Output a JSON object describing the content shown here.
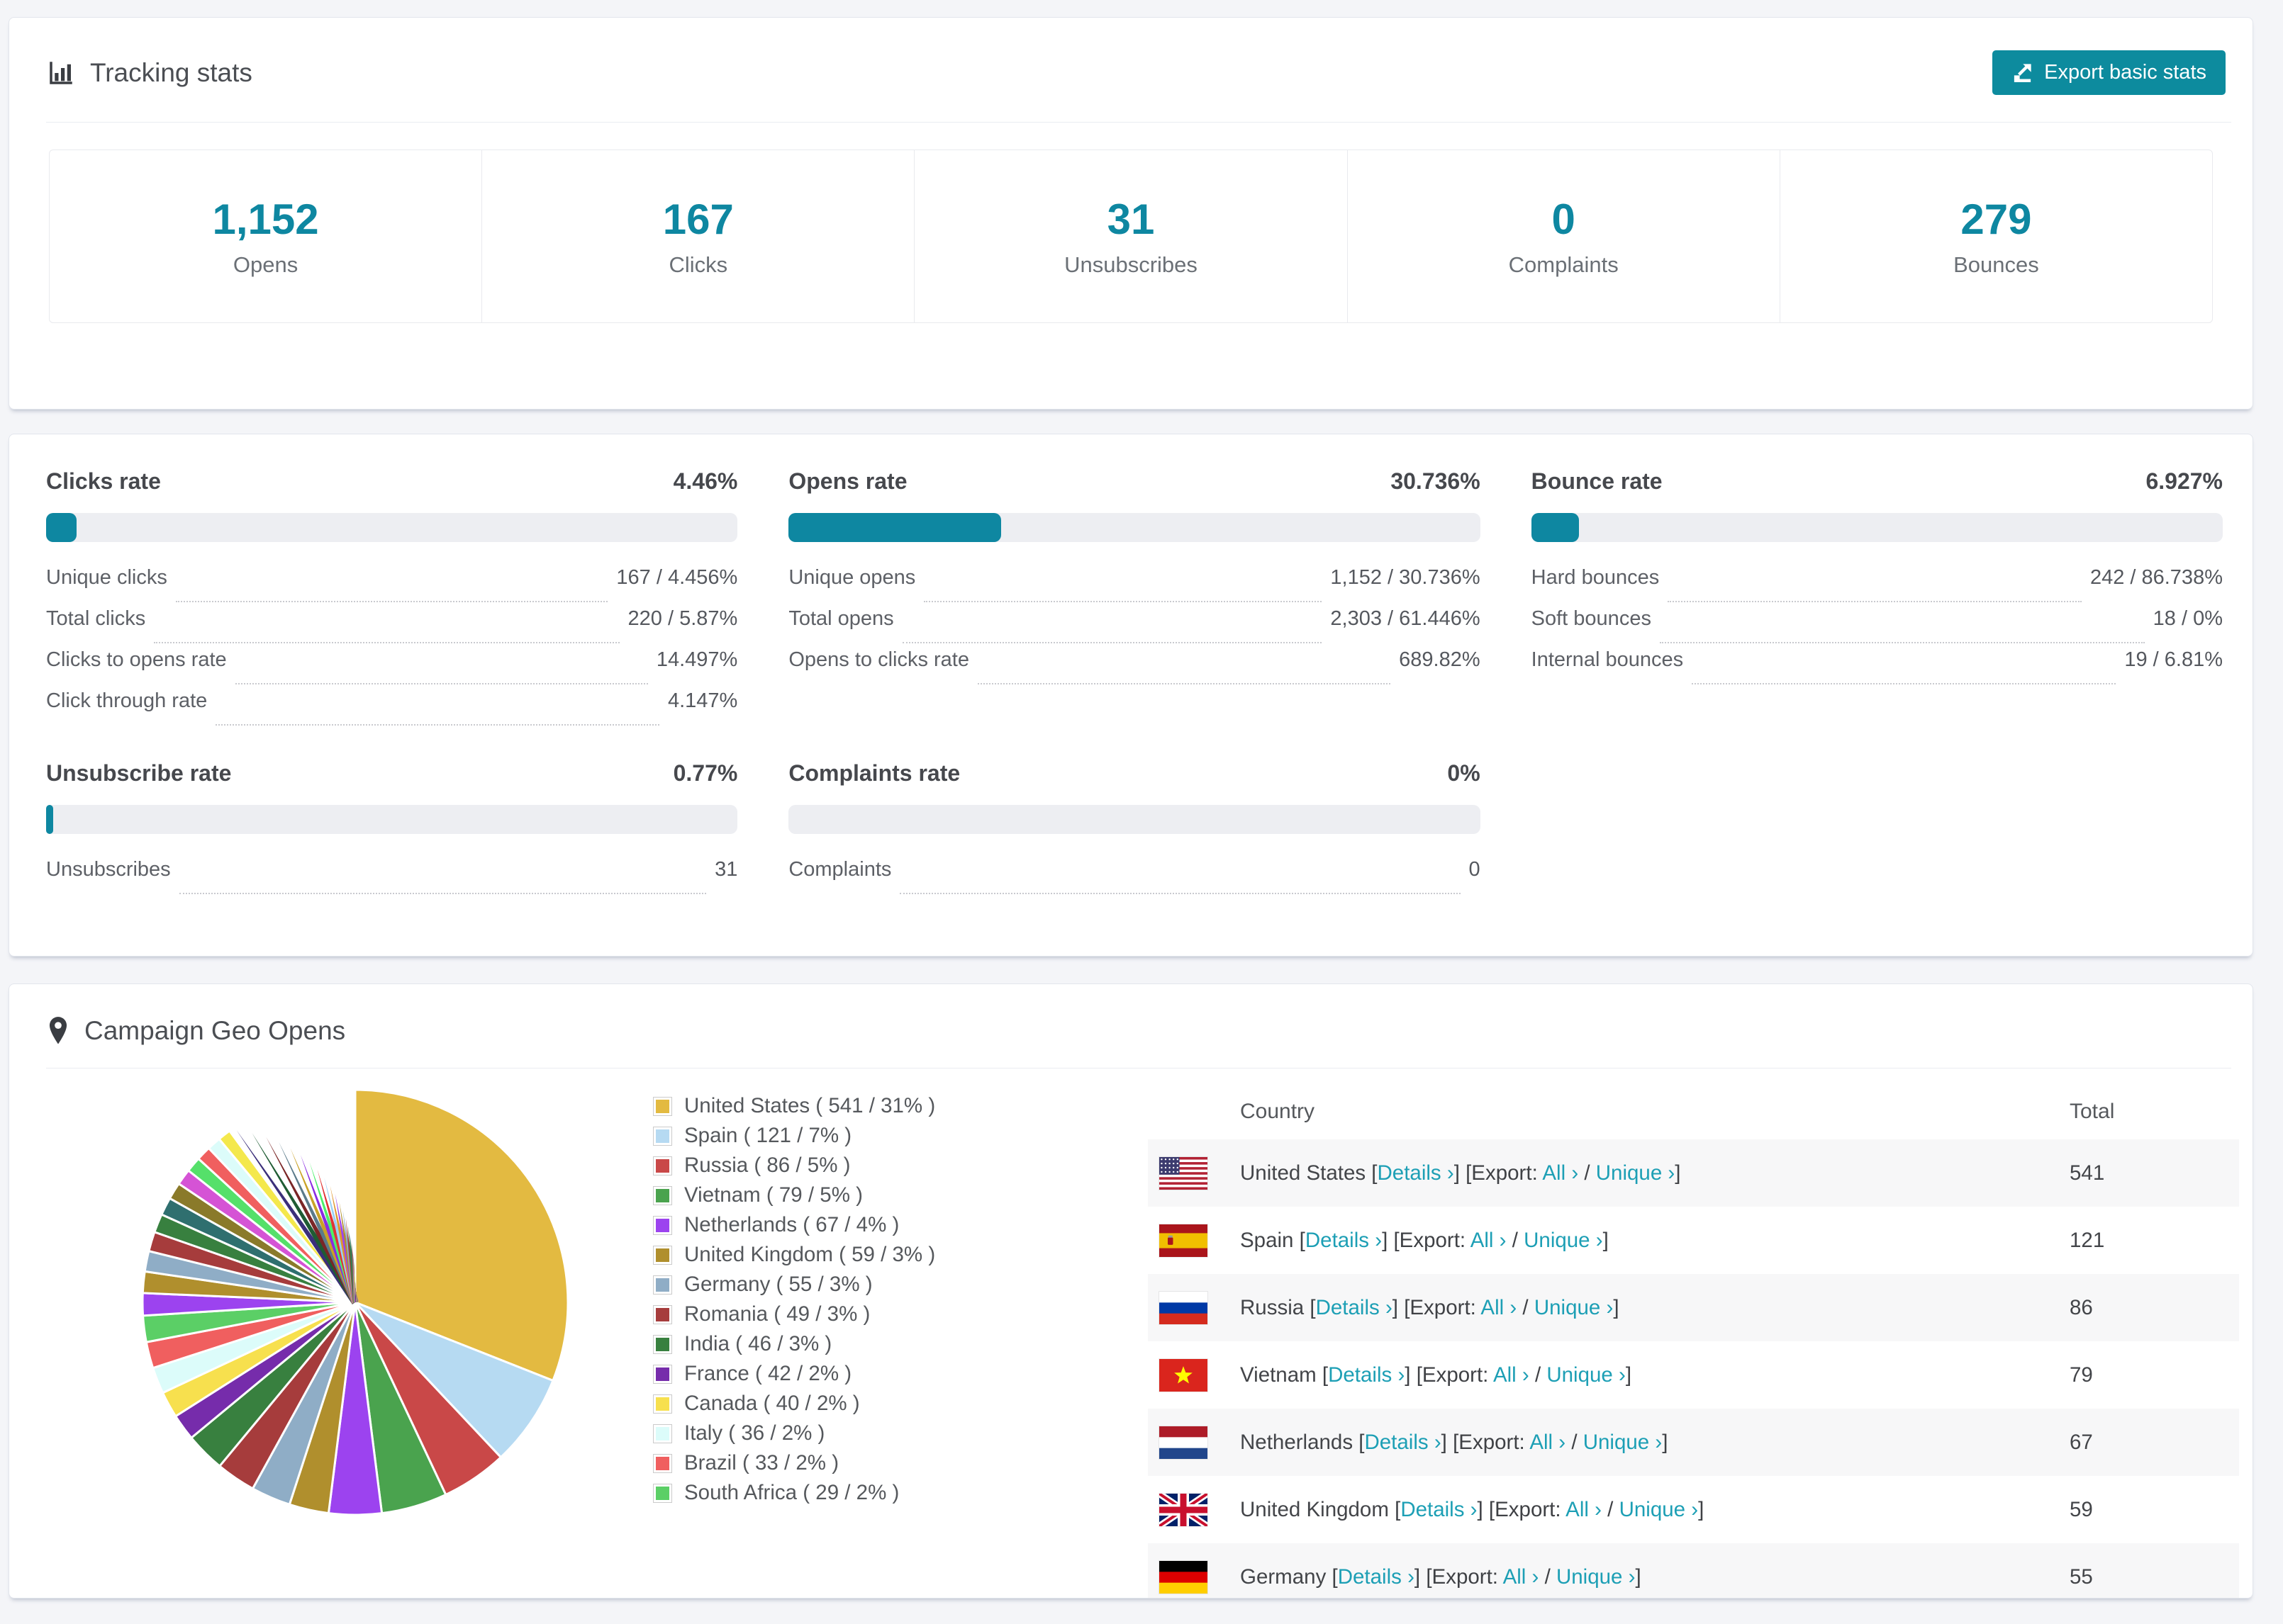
{
  "colors": {
    "accent": "#0e87a1",
    "button": "#0d8b9e",
    "link": "#1d9fb5",
    "bar_track": "#edeef2",
    "page_bg": "#f4f5f8"
  },
  "tracking": {
    "title": "Tracking stats",
    "export_button": "Export basic stats",
    "stats": [
      {
        "value": "1,152",
        "label": "Opens"
      },
      {
        "value": "167",
        "label": "Clicks"
      },
      {
        "value": "31",
        "label": "Unsubscribes"
      },
      {
        "value": "0",
        "label": "Complaints"
      },
      {
        "value": "279",
        "label": "Bounces"
      }
    ]
  },
  "rates": {
    "sections": [
      {
        "title": "Clicks rate",
        "value": "4.46%",
        "pct": 4.46,
        "rows": [
          {
            "label": "Unique clicks",
            "value": "167 / 4.456%"
          },
          {
            "label": "Total clicks",
            "value": "220 / 5.87%"
          },
          {
            "label": "Clicks to opens rate",
            "value": "14.497%"
          },
          {
            "label": "Click through rate",
            "value": "4.147%"
          }
        ]
      },
      {
        "title": "Opens rate",
        "value": "30.736%",
        "pct": 30.736,
        "rows": [
          {
            "label": "Unique opens",
            "value": "1,152 / 30.736%"
          },
          {
            "label": "Total opens",
            "value": "2,303 / 61.446%"
          },
          {
            "label": "Opens to clicks rate",
            "value": "689.82%"
          }
        ]
      },
      {
        "title": "Bounce rate",
        "value": "6.927%",
        "pct": 6.927,
        "rows": [
          {
            "label": "Hard bounces",
            "value": "242 / 86.738%"
          },
          {
            "label": "Soft bounces",
            "value": "18 / 0%"
          },
          {
            "label": "Internal bounces",
            "value": "19 / 6.81%"
          }
        ]
      },
      {
        "title": "Unsubscribe rate",
        "value": "0.77%",
        "pct": 0.77,
        "rows": [
          {
            "label": "Unsubscribes",
            "value": "31"
          }
        ]
      },
      {
        "title": "Complaints rate",
        "value": "0%",
        "pct": 0,
        "rows": [
          {
            "label": "Complaints",
            "value": "0"
          }
        ]
      }
    ]
  },
  "geo": {
    "title": "Campaign Geo Opens",
    "legend_format": "{name} ( {count} / {pct}% )",
    "chart_data": {
      "type": "pie",
      "title": "Campaign Geo Opens",
      "start_angle_deg": 0,
      "direction": "clockwise",
      "legend_position": "right",
      "series": [
        {
          "name": "United States",
          "count": 541,
          "pct": 31,
          "color": "#e3ba41"
        },
        {
          "name": "Spain",
          "count": 121,
          "pct": 7,
          "color": "#b6daf2"
        },
        {
          "name": "Russia",
          "count": 86,
          "pct": 5,
          "color": "#c94848"
        },
        {
          "name": "Vietnam",
          "count": 79,
          "pct": 5,
          "color": "#4aa34e"
        },
        {
          "name": "Netherlands",
          "count": 67,
          "pct": 4,
          "color": "#9c43ef"
        },
        {
          "name": "United Kingdom",
          "count": 59,
          "pct": 3,
          "color": "#b08f2d"
        },
        {
          "name": "Germany",
          "count": 55,
          "pct": 3,
          "color": "#8fadc6"
        },
        {
          "name": "Romania",
          "count": 49,
          "pct": 3,
          "color": "#a63c3c"
        },
        {
          "name": "India",
          "count": 46,
          "pct": 3,
          "color": "#38803f"
        },
        {
          "name": "France",
          "count": 42,
          "pct": 2,
          "color": "#762cab"
        },
        {
          "name": "Canada",
          "count": 40,
          "pct": 2,
          "color": "#f7e04e"
        },
        {
          "name": "Italy",
          "count": 36,
          "pct": 2,
          "color": "#dcfcfa"
        },
        {
          "name": "Brazil",
          "count": 33,
          "pct": 2,
          "color": "#f05f5f"
        },
        {
          "name": "South Africa",
          "count": 29,
          "pct": 2,
          "color": "#5bcf66"
        }
      ],
      "others": {
        "total_pct": 26,
        "approx_slice_count": 40,
        "palette": [
          "#9c43ef",
          "#b08f2d",
          "#8fadc6",
          "#a63c3c",
          "#38803f",
          "#2f6f6f",
          "#8a7a2a",
          "#d553d5",
          "#55e06a",
          "#f05f5f",
          "#dcfcfa",
          "#f4e84c",
          "#3b2f7a",
          "#1f5c33",
          "#7a2626",
          "#5a7a8a",
          "#c9a227",
          "#8a2be2",
          "#4cf06a",
          "#e03535",
          "#9ad0f5",
          "#e0952d"
        ]
      }
    },
    "table": {
      "headers": [
        "Country",
        "Total"
      ],
      "link_details": "Details ›",
      "export_prefix": "[Export:",
      "link_all": "All ›",
      "link_unique": "Unique ›",
      "separator": "/",
      "rows": [
        {
          "flag": "us",
          "country": "United States",
          "total": "541"
        },
        {
          "flag": "es",
          "country": "Spain",
          "total": "121"
        },
        {
          "flag": "ru",
          "country": "Russia",
          "total": "86"
        },
        {
          "flag": "vn",
          "country": "Vietnam",
          "total": "79"
        },
        {
          "flag": "nl",
          "country": "Netherlands",
          "total": "67"
        },
        {
          "flag": "gb",
          "country": "United Kingdom",
          "total": "59"
        },
        {
          "flag": "de",
          "country": "Germany",
          "total": "55"
        }
      ]
    }
  }
}
